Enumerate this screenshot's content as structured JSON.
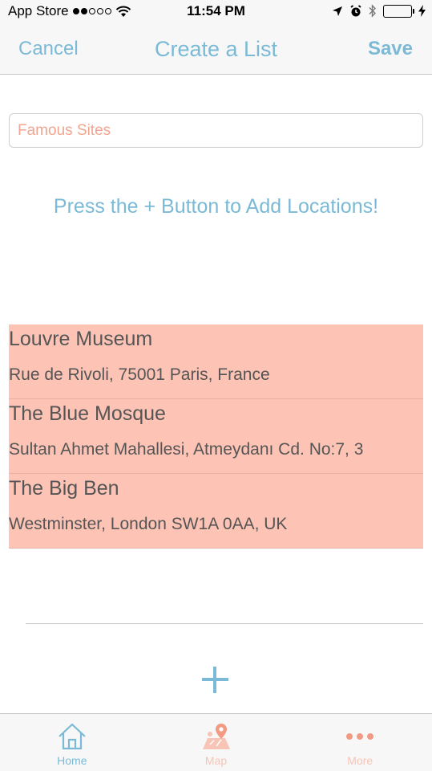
{
  "status_bar": {
    "carrier": "App Store",
    "time": "11:54 PM"
  },
  "nav": {
    "cancel_label": "Cancel",
    "title": "Create a List",
    "save_label": "Save"
  },
  "list_name": {
    "value": "Famous Sites"
  },
  "hint": "Press the + Button to Add Locations!",
  "locations": [
    {
      "name": "Louvre Museum",
      "address": "Rue de Rivoli, 75001 Paris, France"
    },
    {
      "name": "The Blue Mosque",
      "address": "Sultan Ahmet Mahallesi, Atmeydanı Cd. No:7, 3"
    },
    {
      "name": "The Big Ben",
      "address": "Westminster, London SW1A 0AA, UK"
    }
  ],
  "add_button": {
    "icon": "plus-icon"
  },
  "tabs": [
    {
      "label": "Home",
      "icon": "home-icon",
      "active": true
    },
    {
      "label": "Map",
      "icon": "map-pin-icon",
      "active": false
    },
    {
      "label": "More",
      "icon": "more-dots-icon",
      "active": false
    }
  ],
  "colors": {
    "accent": "#7bbad6",
    "salmon": "#fdc4b6",
    "inactive_tab": "#f7c4b5"
  }
}
